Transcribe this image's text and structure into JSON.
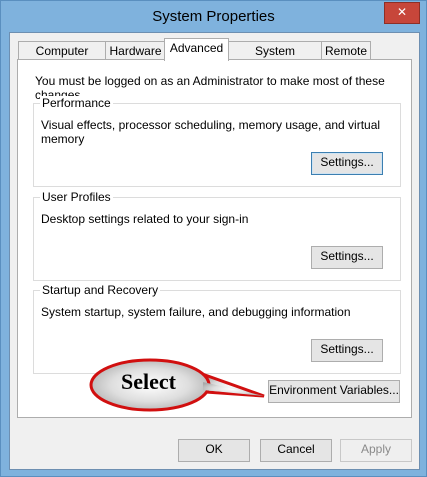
{
  "window": {
    "title": "System Properties",
    "close_glyph": "✕"
  },
  "tabs": [
    {
      "label": "Computer Name"
    },
    {
      "label": "Hardware"
    },
    {
      "label": "Advanced",
      "active": true
    },
    {
      "label": "System Protection"
    },
    {
      "label": "Remote"
    }
  ],
  "panel": {
    "admin_note": "You must be logged on as an Administrator to make most of these changes.",
    "performance": {
      "title": "Performance",
      "description": "Visual effects, processor scheduling, memory usage, and virtual memory",
      "button": "Settings..."
    },
    "user_profiles": {
      "title": "User Profiles",
      "description": "Desktop settings related to your sign-in",
      "button": "Settings..."
    },
    "startup_recovery": {
      "title": "Startup and Recovery",
      "description": "System startup, system failure, and debugging information",
      "button": "Settings..."
    },
    "env_button": "Environment Variables..."
  },
  "callout": {
    "text": "Select",
    "color": "#d10f0f"
  },
  "dialog_buttons": {
    "ok": "OK",
    "cancel": "Cancel",
    "apply": "Apply"
  }
}
